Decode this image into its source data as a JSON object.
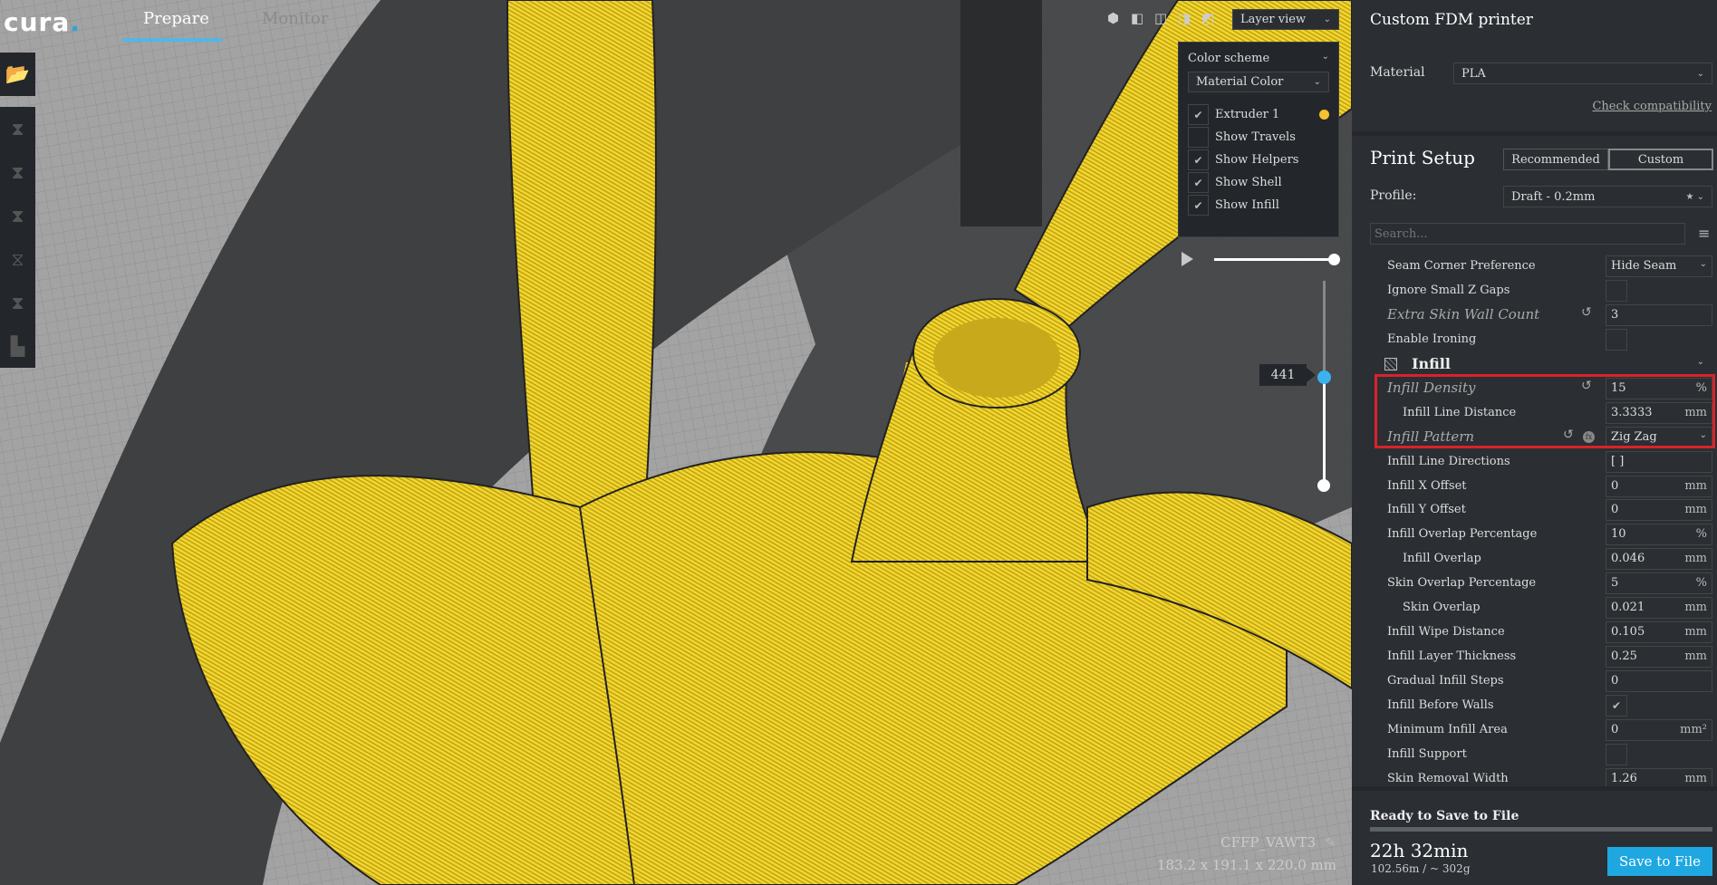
{
  "app": {
    "logo": "cura",
    "tabs": [
      {
        "label": "Prepare",
        "active": true
      },
      {
        "label": "Monitor",
        "active": false
      }
    ]
  },
  "toolbar": {
    "open_icon": "folder-open-icon",
    "tools": [
      "move-icon",
      "scale-icon",
      "rotate-icon",
      "mirror-icon",
      "per-model-settings-icon",
      "support-blocker-icon"
    ]
  },
  "view": {
    "mode": "Layer view",
    "camera_icons": [
      "view-3d-icon",
      "view-front-icon",
      "view-top-icon",
      "view-left-icon",
      "view-right-icon"
    ]
  },
  "color_panel": {
    "title": "Color scheme",
    "scheme": "Material Color",
    "items": [
      {
        "label": "Extruder 1",
        "checked": true,
        "swatch": "#f2c233"
      },
      {
        "label": "Show Travels",
        "checked": false
      },
      {
        "label": "Show Helpers",
        "checked": true
      },
      {
        "label": "Show Shell",
        "checked": true
      },
      {
        "label": "Show Infill",
        "checked": true
      }
    ]
  },
  "layer": {
    "current": "441",
    "vertical_fraction": 0.53,
    "horizontal_fraction": 1.0
  },
  "object": {
    "name": "CFFP_VAWT3",
    "dimensions": "183.2 x 191.1 x 220.0 mm"
  },
  "panel": {
    "printer": "Custom FDM printer",
    "material_label": "Material",
    "material": "PLA",
    "check_compat": "Check compatibility",
    "print_setup": "Print Setup",
    "recommended": "Recommended",
    "custom": "Custom",
    "profile_label": "Profile:",
    "profile": "Draft - 0.2mm",
    "search_placeholder": "Search...",
    "settings": [
      {
        "label": "Seam Corner Preference",
        "type": "select",
        "value": "Hide Seam"
      },
      {
        "label": "Ignore Small Z Gaps",
        "type": "check",
        "value": false
      },
      {
        "label": "Extra Skin Wall Count",
        "type": "text",
        "value": "3",
        "italic": true,
        "reset": true
      },
      {
        "label": "Enable Ironing",
        "type": "check",
        "value": false
      },
      {
        "label": "Infill",
        "type": "category"
      },
      {
        "label": "Infill Density",
        "type": "text",
        "value": "15",
        "unit": "%",
        "italic": true,
        "reset": true
      },
      {
        "label": "Infill Line Distance",
        "type": "text",
        "value": "3.3333",
        "unit": "mm",
        "indent": true
      },
      {
        "label": "Infill Pattern",
        "type": "select",
        "value": "Zig Zag",
        "italic": true,
        "reset": true,
        "fx": true
      },
      {
        "label": "Infill Line Directions",
        "type": "text",
        "value": "[ ]"
      },
      {
        "label": "Infill X Offset",
        "type": "text",
        "value": "0",
        "unit": "mm"
      },
      {
        "label": "Infill Y Offset",
        "type": "text",
        "value": "0",
        "unit": "mm"
      },
      {
        "label": "Infill Overlap Percentage",
        "type": "text",
        "value": "10",
        "unit": "%"
      },
      {
        "label": "Infill Overlap",
        "type": "text",
        "value": "0.046",
        "unit": "mm",
        "indent": true
      },
      {
        "label": "Skin Overlap Percentage",
        "type": "text",
        "value": "5",
        "unit": "%"
      },
      {
        "label": "Skin Overlap",
        "type": "text",
        "value": "0.021",
        "unit": "mm",
        "indent": true
      },
      {
        "label": "Infill Wipe Distance",
        "type": "text",
        "value": "0.105",
        "unit": "mm"
      },
      {
        "label": "Infill Layer Thickness",
        "type": "text",
        "value": "0.25",
        "unit": "mm"
      },
      {
        "label": "Gradual Infill Steps",
        "type": "text",
        "value": "0"
      },
      {
        "label": "Infill Before Walls",
        "type": "check",
        "value": true
      },
      {
        "label": "Minimum Infill Area",
        "type": "text",
        "value": "0",
        "unit": "mm²"
      },
      {
        "label": "Infill Support",
        "type": "check",
        "value": false
      },
      {
        "label": "Skin Removal Width",
        "type": "text",
        "value": "1.26",
        "unit": "mm"
      }
    ]
  },
  "footer": {
    "status": "Ready to Save to File",
    "time": "22h 32min",
    "usage": "102.56m / ~ 302g",
    "save": "Save to File",
    "progress": 1.0
  },
  "colors": {
    "accent": "#1fa7e1",
    "model": "#f2d62e",
    "highlight": "#d8232a"
  }
}
